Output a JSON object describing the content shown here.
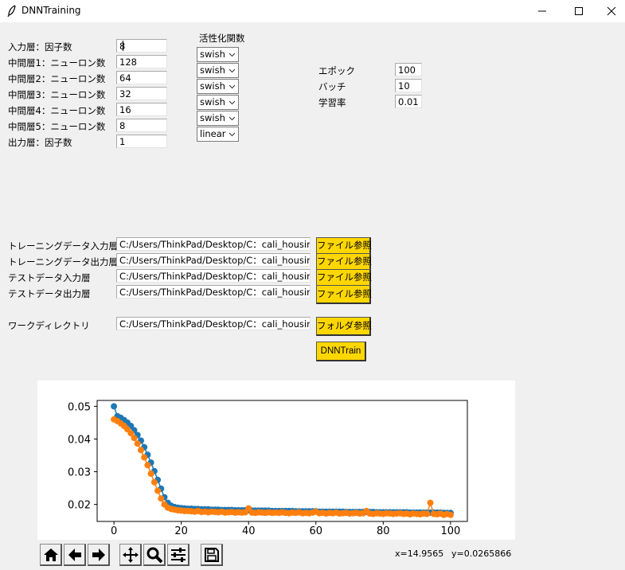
{
  "window": {
    "title": "DNNTraining"
  },
  "layers": [
    {
      "label": "入力層：因子数",
      "value": "8"
    },
    {
      "label": "中間層1：ニューロン数",
      "value": "128"
    },
    {
      "label": "中間層2：ニューロン数",
      "value": "64"
    },
    {
      "label": "中間層3：ニューロン数",
      "value": "32"
    },
    {
      "label": "中間層4：ニューロン数",
      "value": "16"
    },
    {
      "label": "中間層5：ニューロン数",
      "value": "8"
    },
    {
      "label": "出力層：因子数",
      "value": "1"
    }
  ],
  "activation": {
    "header": "活性化関数",
    "options": [
      "swish",
      "swish",
      "swish",
      "swish",
      "swish",
      "linear"
    ]
  },
  "hyper": [
    {
      "label": "エポック",
      "value": "100"
    },
    {
      "label": "バッチ",
      "value": "10"
    },
    {
      "label": "学習率",
      "value": "0.01"
    }
  ],
  "files": [
    {
      "label": "トレーニングデータ入力層",
      "path": "C:/Users/ThinkPad/Desktop/C：cali_housing/",
      "button": "ファイル参照"
    },
    {
      "label": "トレーニングデータ出力層",
      "path": "C:/Users/ThinkPad/Desktop/C：cali_housing/",
      "button": "ファイル参照"
    },
    {
      "label": "テストデータ入力層",
      "path": "C:/Users/ThinkPad/Desktop/C：cali_housing/",
      "button": "ファイル参照"
    },
    {
      "label": "テストデータ出力層",
      "path": "C:/Users/ThinkPad/Desktop/C：cali_housing/",
      "button": "ファイル参照"
    }
  ],
  "workdir": {
    "label": "ワークディレクトリ",
    "path": "C:/Users/ThinkPad/Desktop/C：cali_housing",
    "button": "フォルダ参照"
  },
  "train_button": "DNNTrain",
  "status": {
    "x": "x=14.9565",
    "y": "y=0.0265866"
  },
  "toolbar_icons": [
    "home-icon",
    "back-arrow-icon",
    "forward-arrow-icon",
    "pan-icon",
    "zoom-icon",
    "configure-subplots-icon",
    "save-icon"
  ],
  "colors": {
    "series1": "#1f77b4",
    "series2": "#ff7f0e",
    "button": "#ffd700"
  },
  "chart_data": {
    "type": "line",
    "xlim": [
      -5,
      105
    ],
    "ylim": [
      0.0148,
      0.0518
    ],
    "xticks": [
      0,
      20,
      40,
      60,
      80,
      100
    ],
    "yticks": [
      0.02,
      0.03,
      0.04,
      0.05
    ],
    "xtick_labels": [
      "0",
      "20",
      "40",
      "60",
      "80",
      "100"
    ],
    "ytick_labels": [
      "0.02",
      "0.03",
      "0.04",
      "0.05"
    ],
    "markers": true,
    "series": [
      {
        "color": "#1f77b4",
        "x": [
          0,
          1,
          2,
          3,
          4,
          5,
          6,
          7,
          8,
          9,
          10,
          11,
          12,
          13,
          14,
          15,
          16,
          17,
          18,
          19,
          20,
          21,
          22,
          23,
          24,
          25,
          26,
          27,
          28,
          29,
          30,
          31,
          32,
          33,
          34,
          35,
          36,
          37,
          38,
          39,
          40,
          41,
          42,
          43,
          44,
          45,
          46,
          47,
          48,
          49,
          50,
          51,
          52,
          53,
          54,
          55,
          56,
          57,
          58,
          59,
          60,
          61,
          62,
          63,
          64,
          65,
          66,
          67,
          68,
          69,
          70,
          71,
          72,
          73,
          74,
          75,
          76,
          77,
          78,
          79,
          80,
          81,
          82,
          83,
          84,
          85,
          86,
          87,
          88,
          89,
          90,
          91,
          92,
          93,
          94,
          95,
          96,
          97,
          98,
          99,
          100
        ],
        "y": [
          0.05,
          0.047,
          0.0465,
          0.0458,
          0.045,
          0.044,
          0.0427,
          0.0412,
          0.0395,
          0.0375,
          0.0352,
          0.0328,
          0.0302,
          0.0275,
          0.0248,
          0.0222,
          0.0205,
          0.0196,
          0.0192,
          0.019,
          0.0189,
          0.0188,
          0.0187,
          0.0187,
          0.0186,
          0.0186,
          0.0185,
          0.0185,
          0.0185,
          0.0184,
          0.0184,
          0.0184,
          0.0183,
          0.0183,
          0.0183,
          0.0183,
          0.0182,
          0.0182,
          0.0182,
          0.0182,
          0.0182,
          0.0181,
          0.0181,
          0.0181,
          0.0181,
          0.0181,
          0.0181,
          0.018,
          0.018,
          0.018,
          0.018,
          0.018,
          0.018,
          0.018,
          0.0179,
          0.0179,
          0.0179,
          0.0179,
          0.0179,
          0.0179,
          0.0179,
          0.0178,
          0.0178,
          0.0178,
          0.0178,
          0.0178,
          0.0178,
          0.0178,
          0.0178,
          0.0177,
          0.0177,
          0.0177,
          0.0177,
          0.0177,
          0.0177,
          0.0177,
          0.0177,
          0.0177,
          0.0176,
          0.0176,
          0.0176,
          0.0176,
          0.0176,
          0.0176,
          0.0176,
          0.0176,
          0.0176,
          0.0176,
          0.0175,
          0.0175,
          0.0175,
          0.0175,
          0.0175,
          0.0175,
          0.0175,
          0.0175,
          0.0175,
          0.0175,
          0.0174,
          0.0174,
          0.0174
        ]
      },
      {
        "color": "#ff7f0e",
        "x": [
          0,
          1,
          2,
          3,
          4,
          5,
          6,
          7,
          8,
          9,
          10,
          11,
          12,
          13,
          14,
          15,
          16,
          17,
          18,
          19,
          20,
          21,
          22,
          23,
          24,
          25,
          26,
          27,
          28,
          29,
          30,
          31,
          32,
          33,
          34,
          35,
          36,
          37,
          38,
          39,
          40,
          41,
          42,
          43,
          44,
          45,
          46,
          47,
          48,
          49,
          50,
          51,
          52,
          53,
          54,
          55,
          56,
          57,
          58,
          59,
          60,
          61,
          62,
          63,
          64,
          65,
          66,
          67,
          68,
          69,
          70,
          71,
          72,
          73,
          74,
          75,
          76,
          77,
          78,
          79,
          80,
          81,
          82,
          83,
          84,
          85,
          86,
          87,
          88,
          89,
          90,
          91,
          92,
          93,
          94,
          95,
          96,
          97,
          98,
          99,
          100
        ],
        "y": [
          0.046,
          0.0455,
          0.0448,
          0.044,
          0.043,
          0.0418,
          0.0403,
          0.0386,
          0.0366,
          0.0344,
          0.032,
          0.0294,
          0.0268,
          0.0242,
          0.0218,
          0.02,
          0.019,
          0.0186,
          0.0184,
          0.0182,
          0.0181,
          0.018,
          0.018,
          0.0179,
          0.0178,
          0.018,
          0.0177,
          0.0178,
          0.0176,
          0.0178,
          0.0177,
          0.0176,
          0.0178,
          0.0175,
          0.0176,
          0.0177,
          0.0175,
          0.0176,
          0.0175,
          0.0176,
          0.0188,
          0.0175,
          0.0174,
          0.0176,
          0.0175,
          0.0174,
          0.0176,
          0.0174,
          0.0175,
          0.0174,
          0.0176,
          0.0174,
          0.0173,
          0.0175,
          0.0174,
          0.0176,
          0.0173,
          0.0174,
          0.0173,
          0.0175,
          0.0178,
          0.0173,
          0.0174,
          0.0172,
          0.0174,
          0.0173,
          0.0175,
          0.0172,
          0.0173,
          0.0174,
          0.0172,
          0.0173,
          0.0174,
          0.0172,
          0.0173,
          0.018,
          0.0172,
          0.0171,
          0.0173,
          0.0172,
          0.0171,
          0.0173,
          0.0172,
          0.0171,
          0.0172,
          0.0173,
          0.0171,
          0.0172,
          0.017,
          0.0172,
          0.0171,
          0.017,
          0.0172,
          0.0171,
          0.0205,
          0.0171,
          0.017,
          0.0172,
          0.0168,
          0.0171,
          0.0168
        ]
      }
    ]
  }
}
